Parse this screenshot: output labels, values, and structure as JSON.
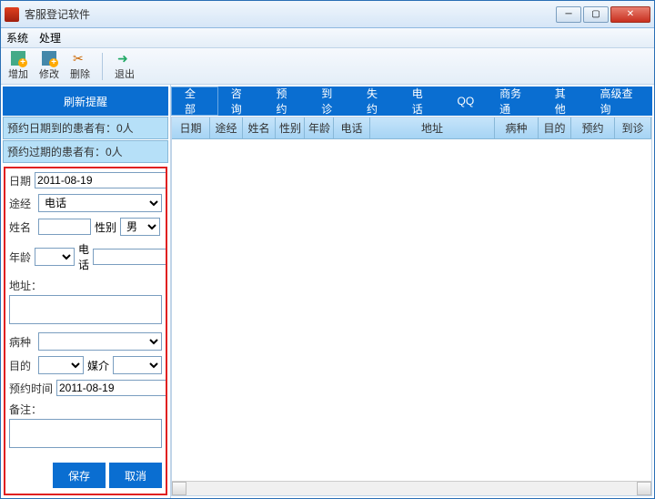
{
  "window": {
    "title": "客服登记软件"
  },
  "menu": {
    "system": "系统",
    "process": "处理"
  },
  "toolbar": {
    "add": "增加",
    "edit": "修改",
    "del": "删除",
    "exit": "退出"
  },
  "sidebar": {
    "refresh": "刷新提醒",
    "reminder_today": "预约日期到的患者有：0人",
    "reminder_overdue": "预约过期的患者有：0人"
  },
  "form": {
    "labels": {
      "date": "日期",
      "via": "途经",
      "name": "姓名",
      "gender": "性别",
      "age": "年龄",
      "phone": "电话",
      "address": "地址：",
      "disease": "病种",
      "purpose": "目的",
      "media": "媒介",
      "appt": "预约时间",
      "remark": "备注："
    },
    "values": {
      "date": "2011-08-19",
      "via": "电话",
      "name": "",
      "gender": "男",
      "age": "",
      "phone": "",
      "address": "",
      "disease": "",
      "purpose": "",
      "media": "",
      "appt": "2011-08-19",
      "remark": ""
    },
    "buttons": {
      "save": "保存",
      "cancel": "取消"
    }
  },
  "tabs": [
    "全部",
    "咨询",
    "预约",
    "到诊",
    "失约",
    "电话",
    "QQ",
    "商务通",
    "其他",
    "高级查询"
  ],
  "grid": {
    "columns": [
      "日期",
      "途经",
      "姓名",
      "性别",
      "年龄",
      "电话",
      "地址",
      "病种",
      "目的",
      "预约",
      "到诊"
    ]
  }
}
